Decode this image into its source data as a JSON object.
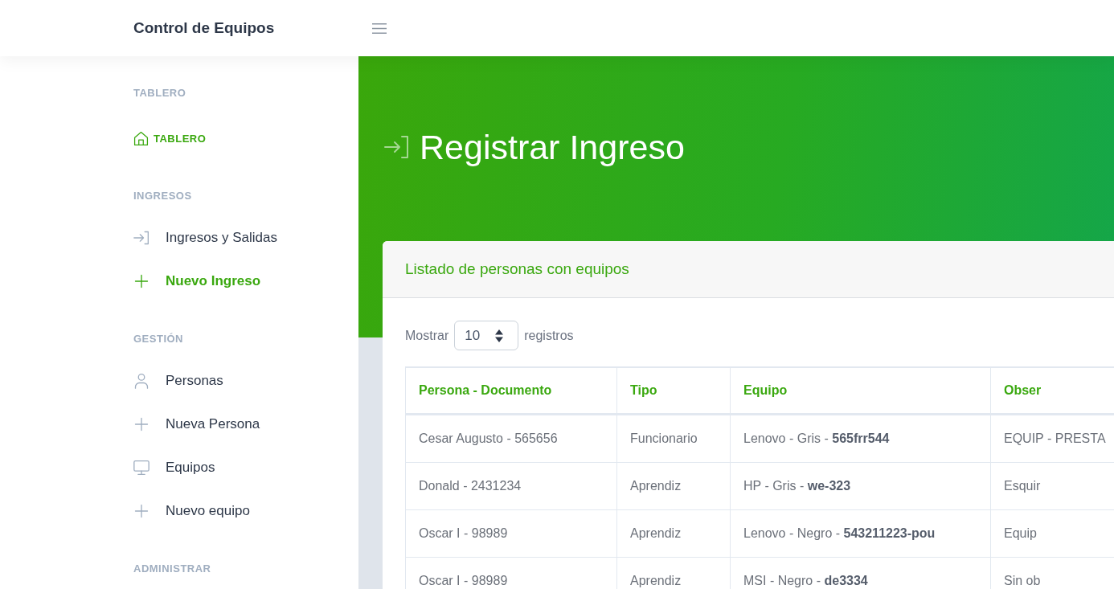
{
  "topbar": {
    "brand": "Control de Equipos"
  },
  "sidebar": {
    "sections": [
      {
        "heading": "TABLERO",
        "items": [
          {
            "label": "TABLERO",
            "kind": "dashboard",
            "selected": true
          }
        ]
      },
      {
        "heading": "INGRESOS",
        "items": [
          {
            "label": "Ingresos y Salidas",
            "kind": "link",
            "selected": false
          },
          {
            "label": "Nuevo Ingreso",
            "kind": "link",
            "selected": true
          }
        ]
      },
      {
        "heading": "GESTIÓN",
        "items": [
          {
            "label": "Personas",
            "kind": "link",
            "selected": false
          },
          {
            "label": "Nueva Persona",
            "kind": "link",
            "selected": false
          },
          {
            "label": "Equipos",
            "kind": "link",
            "selected": false
          },
          {
            "label": "Nuevo equipo",
            "kind": "link",
            "selected": false
          }
        ]
      },
      {
        "heading": "ADMINISTRAR"
      }
    ]
  },
  "page_header": {
    "title": "Registrar Ingreso"
  },
  "card": {
    "title": "Listado de personas con equipos",
    "length_menu": {
      "before": "Mostrar",
      "value": "10",
      "after": "registros"
    },
    "table": {
      "columns": [
        "Persona - Documento",
        "Tipo",
        "Equipo",
        "Obser"
      ],
      "rows": [
        [
          "Cesar Augusto - 565656",
          "Funcionario",
          "Lenovo - Gris - **565frr544**",
          "EQUIP - PRESTA"
        ],
        [
          "Donald - 2431234",
          "Aprendiz",
          "HP - Gris - **we-323**",
          "Esquir"
        ],
        [
          "Oscar I - 98989",
          "Aprendiz",
          "Lenovo - Negro - **543211223-pou**",
          "Equip"
        ],
        [
          "Oscar I - 98989",
          "Aprendiz",
          "MSI - Negro - **de3334**",
          "Sin ob"
        ]
      ]
    }
  }
}
